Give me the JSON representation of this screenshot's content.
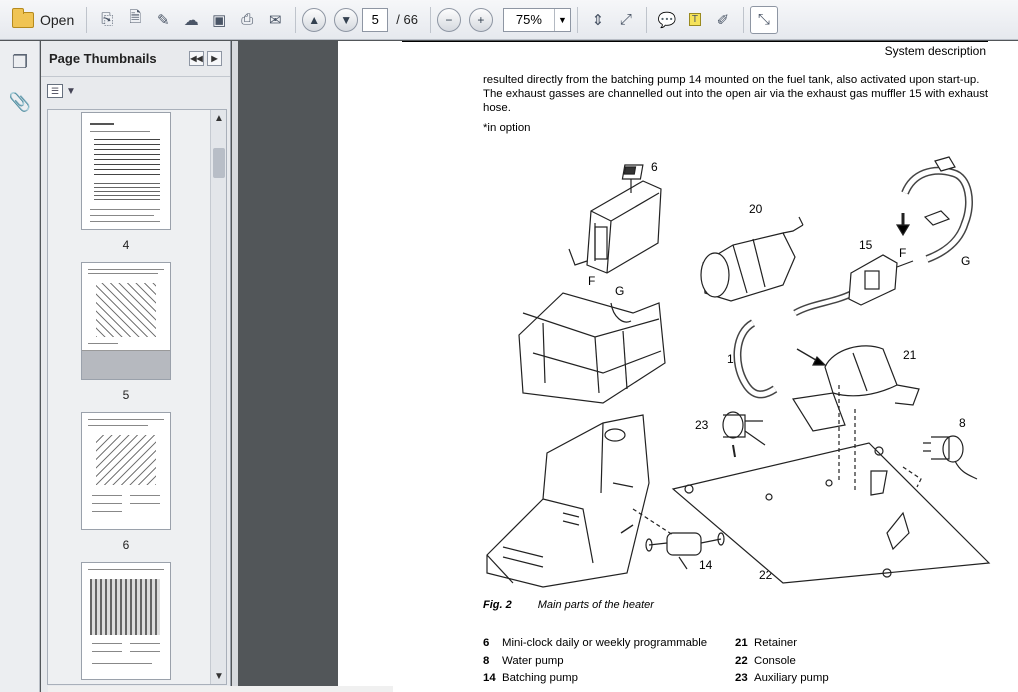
{
  "toolbar": {
    "open_label": "Open",
    "current_page": "5",
    "page_total": "/ 66",
    "zoom": "75%"
  },
  "panel": {
    "title": "Page Thumbnails",
    "thumbnails": [
      {
        "label": "4"
      },
      {
        "label": "5"
      },
      {
        "label": "6"
      },
      {
        "label": ""
      }
    ]
  },
  "document": {
    "header": "System description",
    "paragraph": "resulted directly from the batching pump 14 mounted on the fuel tank, also activated upon start-up. The exhaust gasses are channelled out into the open air via the exhaust gas muffler 15 with exhaust hose.",
    "note": "*in option",
    "figure_labels": {
      "l6": "6",
      "l20": "20",
      "l15": "15",
      "lF1": "F",
      "lG1": "G",
      "lF2": "F",
      "lG2": "G",
      "l18": "18",
      "l21": "21",
      "l23": "23",
      "l8": "8",
      "l22": "22",
      "l14": "14"
    },
    "caption_num": "Fig. 2",
    "caption_text": "Main parts of the heater",
    "legend_left": [
      {
        "num": "6",
        "text": "Mini-clock daily or weekly programmable"
      },
      {
        "num": "8",
        "text": "Water pump"
      },
      {
        "num": "14",
        "text": "Batching pump"
      }
    ],
    "legend_right": [
      {
        "num": "21",
        "text": "Retainer"
      },
      {
        "num": "22",
        "text": "Console"
      },
      {
        "num": "23",
        "text": "Auxiliary pump"
      }
    ]
  }
}
